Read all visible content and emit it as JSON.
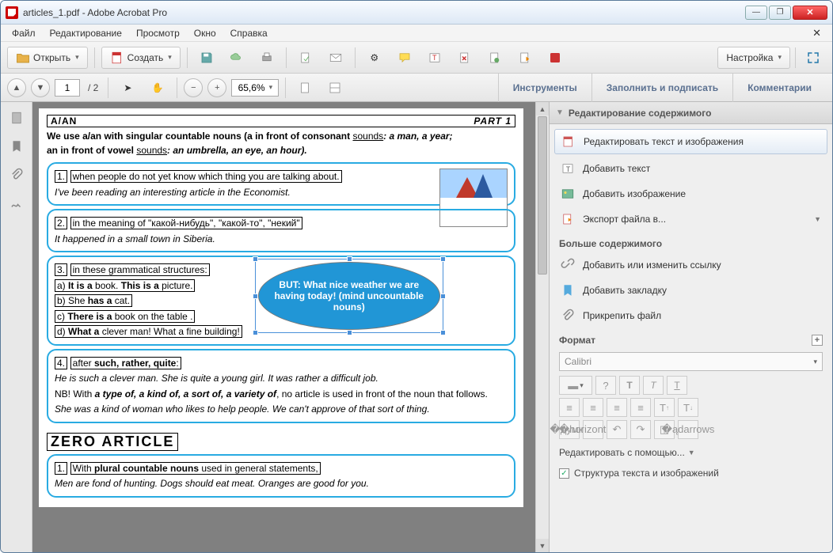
{
  "window": {
    "title": "articles_1.pdf - Adobe Acrobat Pro"
  },
  "menu": {
    "file": "Файл",
    "edit": "Редактирование",
    "view": "Просмотр",
    "window": "Окно",
    "help": "Справка"
  },
  "toolbar": {
    "open": "Открыть",
    "create": "Создать",
    "customize": "Настройка"
  },
  "nav": {
    "page": "1",
    "total": "/ 2",
    "zoom": "65,6%"
  },
  "rightTabs": {
    "tools": "Инструменты",
    "fill": "Заполнить и подписать",
    "comments": "Комментарии"
  },
  "panel": {
    "header": "Редактирование содержимого",
    "editTextImg": "Редактировать текст и изображения",
    "addText": "Добавить текст",
    "addImage": "Добавить изображение",
    "exportFile": "Экспорт файла в...",
    "moreContent": "Больше содержимого",
    "addLink": "Добавить или изменить ссылку",
    "addBookmark": "Добавить закладку",
    "attachFile": "Прикрепить файл",
    "format": "Формат",
    "font": "Calibri",
    "question": "?",
    "editWith": "Редактировать с помощью...",
    "structure": "Структура текста и изображений"
  },
  "doc": {
    "h1": "A/AN",
    "h1r": "PART 1",
    "intro1": "We use a/an with singular countable nouns (a in front of consonant ",
    "intro1u": "sounds",
    "intro1b": ": a man, a year;",
    "intro2": "an in front of vowel ",
    "intro2u": "sounds",
    "intro2b": ": an umbrella, an eye, an hour).",
    "b1_1": "1.",
    "b1_2": "when people do not yet know which thing you are talking about.",
    "b1_3": "I've been reading an interesting article in the Economist.",
    "b2_1": "2.",
    "b2_2": "in the meaning of \"какой-нибудь\", \"какой-то\", \"некий\"",
    "b2_3": "It happened in a small town in Siberia.",
    "b3_1": "3.",
    "b3_2": "in these grammatical structures:",
    "b3_a": "a) It is a book. This is a picture.",
    "b3_b": "b) She has a cat.",
    "b3_c": "c) There is a book on the table .",
    "b3_d": "d) What a clever man! What a fine building!",
    "ellipse": "BUT: What nice weather we are having today! (mind uncountable nouns)",
    "b4_1": "4.",
    "b4_2": "after such, rather, quite:",
    "b4_3": "He is such a clever man.   She is quite a young girl.   It was rather a difficult job.",
    "b4_4a": "NB! With ",
    "b4_4b": "a type of, a kind of, a sort of, a variety of",
    "b4_4c": ", no article is used in front of the noun that follows.",
    "b4_5": "She was a kind of woman who likes to help people.    We can't approve of that sort of thing.",
    "zero": "ZERO ARTICLE",
    "z1_1": "1.",
    "z1_2": "With plural countable nouns used in general statements,",
    "z1_3": "Men are fond of hunting.       Dogs should eat meat.        Oranges are good for you."
  }
}
